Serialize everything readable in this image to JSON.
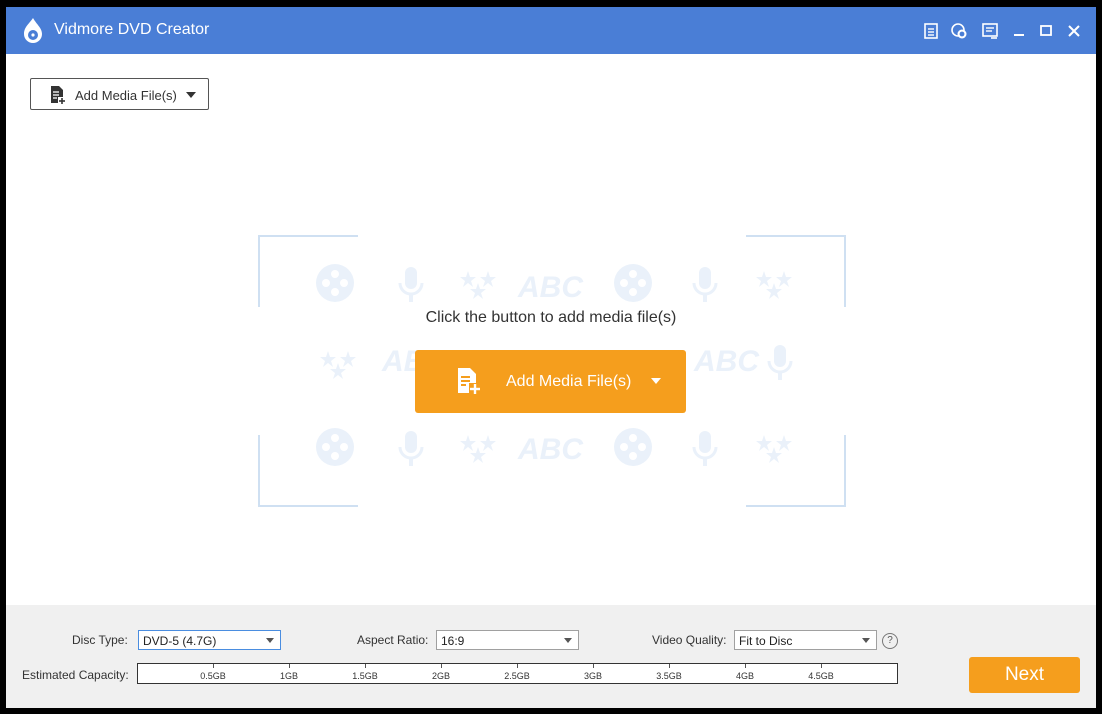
{
  "window": {
    "title": "Vidmore DVD Creator"
  },
  "titlebar_icons": [
    "save-icon",
    "chat-icon",
    "menu-icon",
    "minimize-icon",
    "maximize-icon",
    "close-icon"
  ],
  "toolbar": {
    "add_media_label": "Add Media File(s)"
  },
  "main": {
    "prompt": "Click the button to add media file(s)",
    "add_media_label": "Add Media File(s)",
    "watermark_text": "ABC"
  },
  "bottom": {
    "disc_type_label": "Disc Type:",
    "disc_type_value": "DVD-5 (4.7G)",
    "aspect_ratio_label": "Aspect Ratio:",
    "aspect_ratio_value": "16:9",
    "video_quality_label": "Video Quality:",
    "video_quality_value": "Fit to Disc",
    "help_label": "?",
    "capacity_label": "Estimated Capacity:",
    "capacity_ticks": [
      "0.5GB",
      "1GB",
      "1.5GB",
      "2GB",
      "2.5GB",
      "3GB",
      "3.5GB",
      "4GB",
      "4.5GB"
    ],
    "next_label": "Next"
  },
  "colors": {
    "titlebar": "#4a7ed6",
    "accent": "#f59e1d",
    "watermark": "#eaf1fa"
  }
}
